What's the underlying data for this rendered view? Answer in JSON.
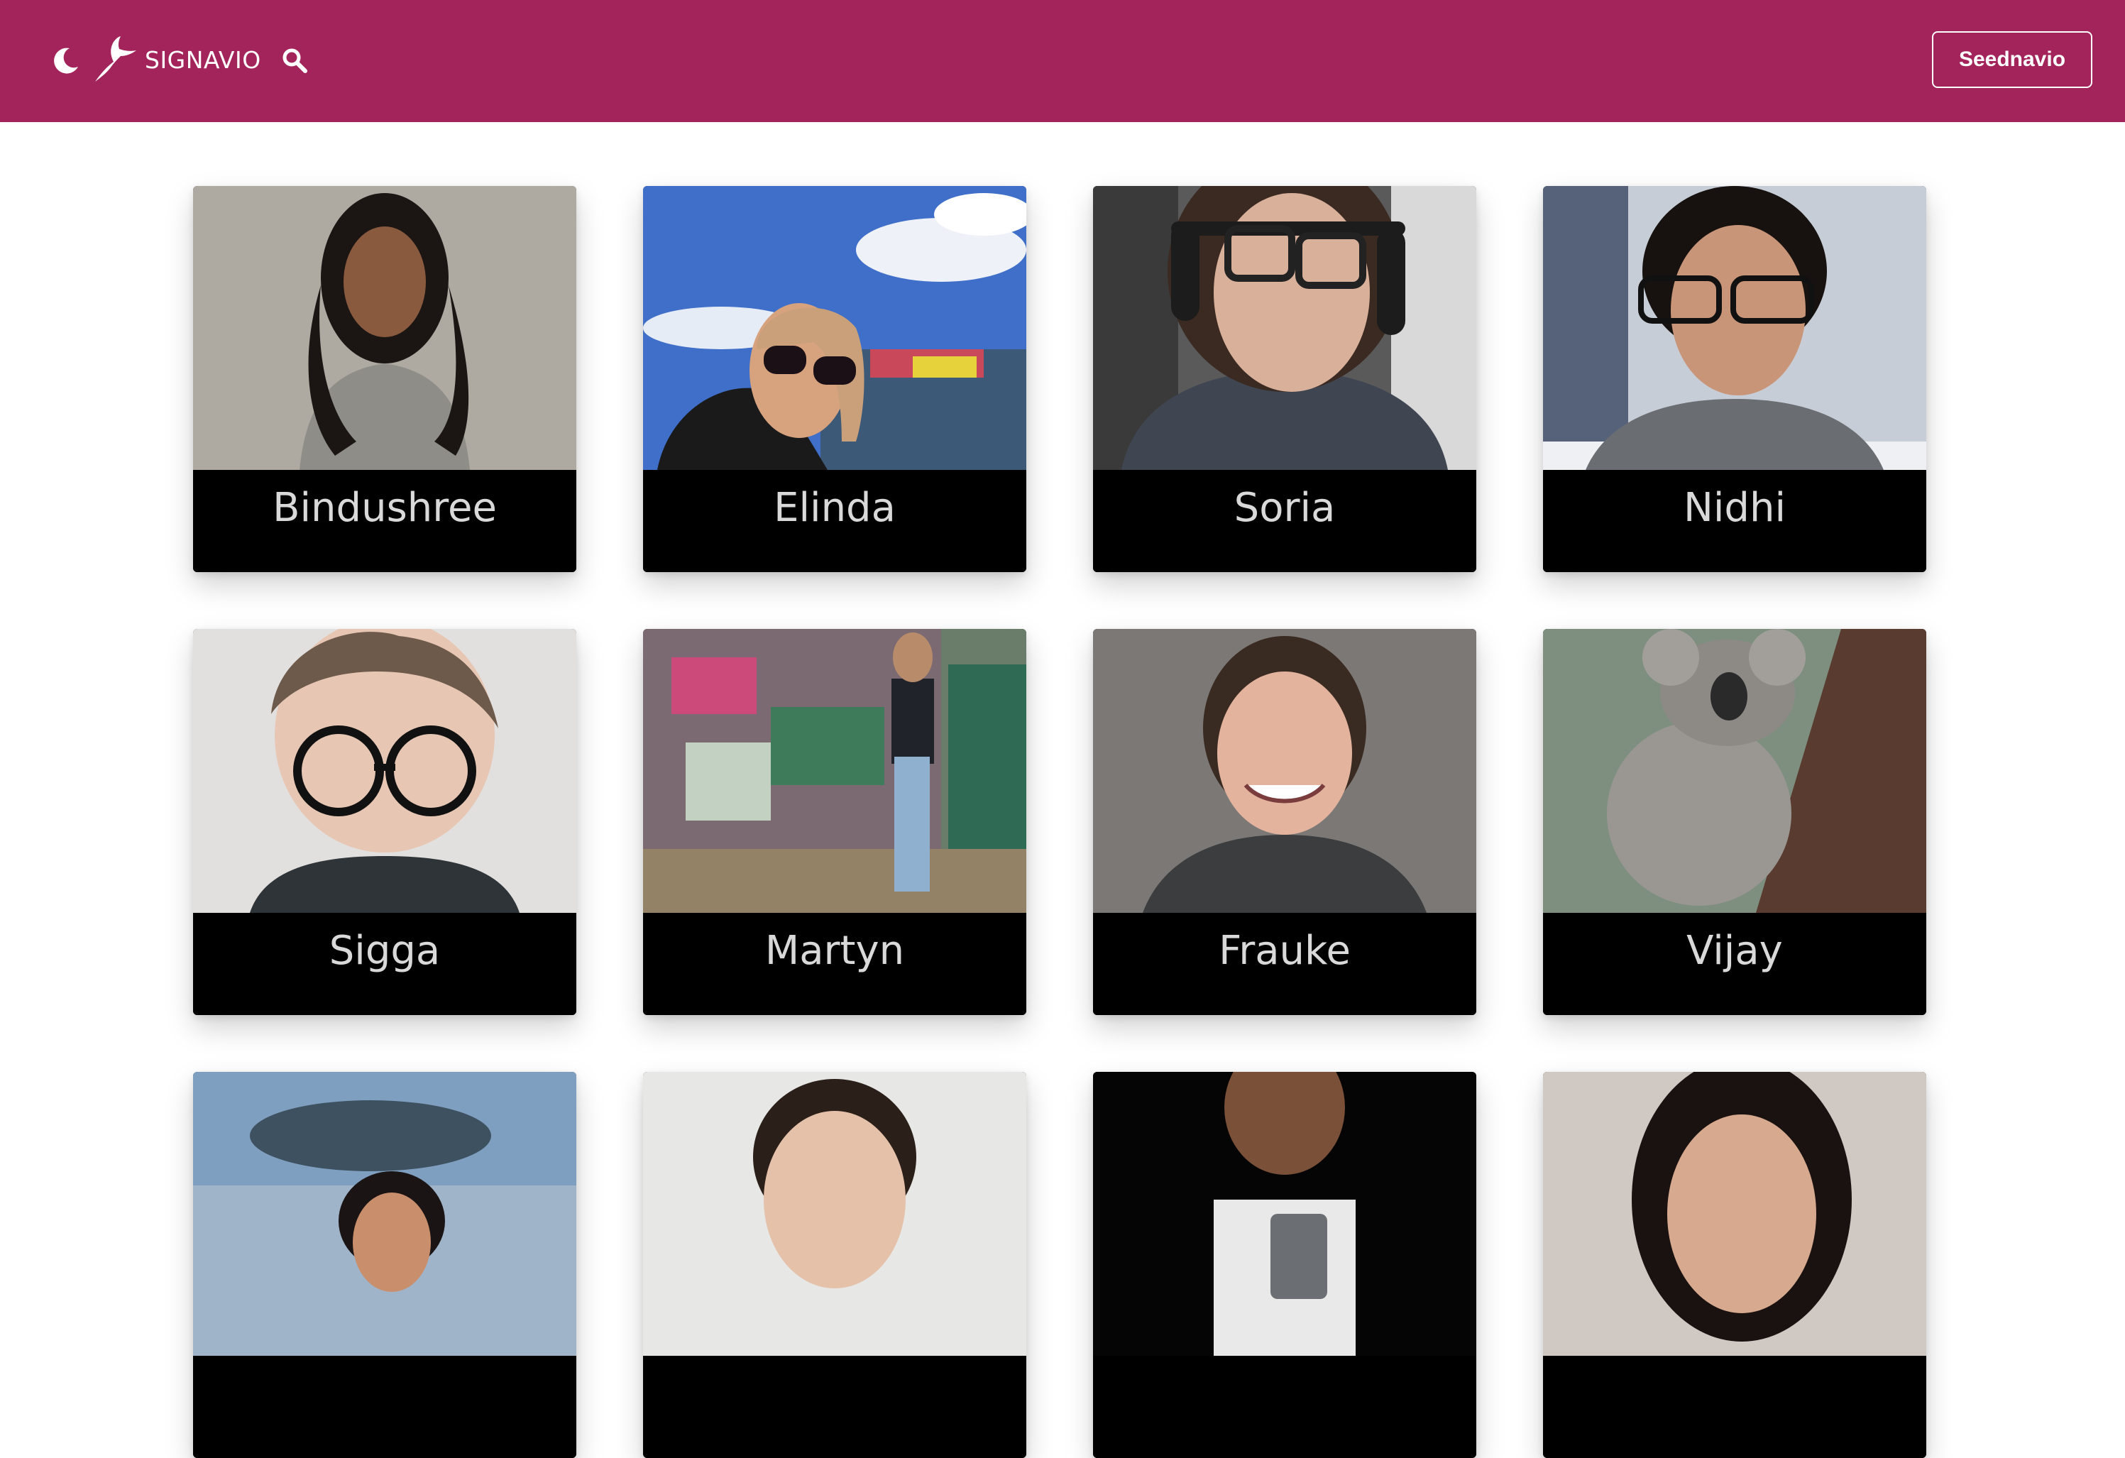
{
  "header": {
    "brand": "SIGNAVIO",
    "button_label": "Seednavio",
    "bg_color": "#a3245a"
  },
  "icons": {
    "theme": "moon-icon",
    "logo": "gazelle-logo",
    "search": "search-icon"
  },
  "people": [
    {
      "name": "Bindushree"
    },
    {
      "name": "Elinda"
    },
    {
      "name": "Soria"
    },
    {
      "name": "Nidhi"
    },
    {
      "name": "Sigga"
    },
    {
      "name": "Martyn"
    },
    {
      "name": "Frauke"
    },
    {
      "name": "Vijay"
    },
    {
      "name": ""
    },
    {
      "name": ""
    },
    {
      "name": ""
    },
    {
      "name": ""
    }
  ]
}
